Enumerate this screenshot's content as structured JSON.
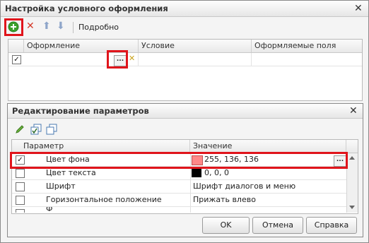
{
  "outer": {
    "title": "Настройка условного оформления",
    "close_glyph": "✕",
    "toolbar": {
      "add_icon": "add-circle-icon",
      "delete_glyph": "✕",
      "up_glyph": "⬆",
      "down_glyph": "⬇",
      "details_label": "Подробно"
    },
    "table": {
      "columns": [
        "Оформление",
        "Условие",
        "Оформляемые поля"
      ],
      "rows": [
        {
          "checked": true,
          "appearance": "",
          "condition": "",
          "fields": ""
        }
      ],
      "ellipsis_label": "...",
      "clear_glyph": "✕",
      "check_glyph": "✓"
    }
  },
  "dialog": {
    "title": "Редактирование параметров",
    "close_glyph": "✕",
    "toolbar": {
      "edit_icon": "pencil-icon",
      "check_all_icon": "check-all-icon",
      "uncheck_all_icon": "uncheck-all-icon"
    },
    "table": {
      "columns": [
        "Параметр",
        "Значение"
      ],
      "rows": [
        {
          "checked": true,
          "param": "Цвет фона",
          "value": "255, 136, 136",
          "swatch": "#ff8888",
          "ellipsis": "..."
        },
        {
          "checked": false,
          "param": "Цвет текста",
          "value": "0, 0, 0",
          "swatch": "#000000"
        },
        {
          "checked": false,
          "param": "Шрифт",
          "value": "Шрифт диалогов и меню"
        },
        {
          "checked": false,
          "param": "Горизонтальное положение",
          "value": "Прижать влево"
        },
        {
          "checked": false,
          "param": "Ф",
          "value": ""
        }
      ],
      "check_glyph": "✓"
    },
    "buttons": {
      "ok": "OK",
      "cancel": "Отмена",
      "help": "Справка"
    }
  },
  "colors": {
    "highlight_red": "#e0141b",
    "add_green": "#3aa02c",
    "delete_red": "#d43a2a"
  }
}
